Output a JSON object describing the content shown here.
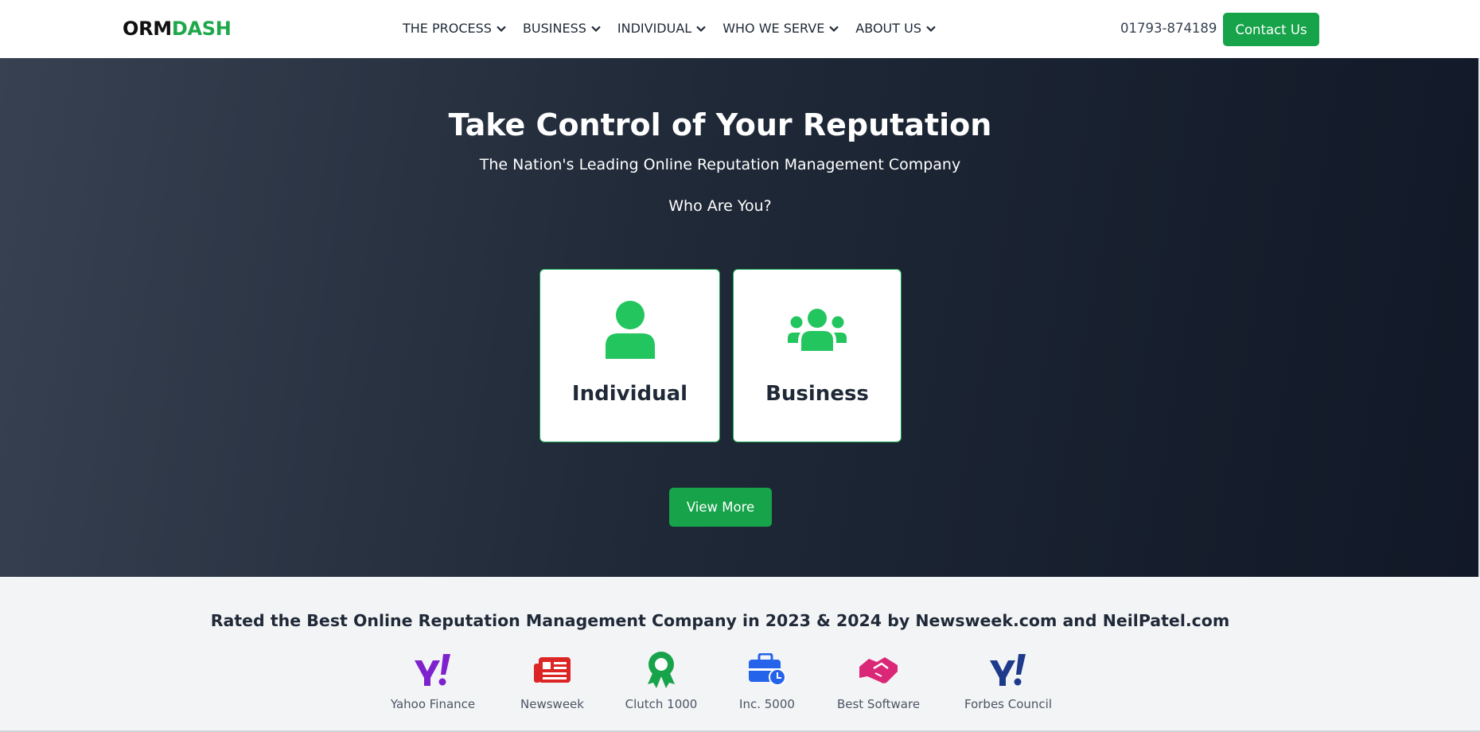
{
  "header": {
    "logo_part1": "ORM",
    "logo_part2": "DASH",
    "nav": [
      {
        "label": "THE PROCESS"
      },
      {
        "label": "BUSINESS"
      },
      {
        "label": "INDIVIDUAL"
      },
      {
        "label": "WHO WE SERVE"
      },
      {
        "label": "ABOUT US"
      }
    ],
    "phone": "01793-874189",
    "contact_label": "Contact Us"
  },
  "hero": {
    "title": "Take Control of Your Reputation",
    "subtitle": "The Nation's Leading Online Reputation Management Company",
    "question": "Who Are You?",
    "cards": [
      {
        "label": "Individual",
        "icon": "user-icon"
      },
      {
        "label": "Business",
        "icon": "users-group-icon"
      }
    ],
    "view_more_label": "View More"
  },
  "ratings": {
    "title": "Rated the Best Online Reputation Management Company in 2023 & 2024 by Newsweek.com and NeilPatel.com",
    "badges": [
      {
        "label": "Yahoo Finance",
        "icon": "yahoo-icon",
        "color": "#7e22ce"
      },
      {
        "label": "Newsweek",
        "icon": "newspaper-icon",
        "color": "#dc2626"
      },
      {
        "label": "Clutch 1000",
        "icon": "award-icon",
        "color": "#16a34a"
      },
      {
        "label": "Inc. 5000",
        "icon": "briefcase-clock-icon",
        "color": "#2563eb"
      },
      {
        "label": "Best Software",
        "icon": "handshake-icon",
        "color": "#db2777"
      },
      {
        "label": "Forbes Council",
        "icon": "yahoo-icon",
        "color": "#1e3a8a"
      }
    ]
  },
  "colors": {
    "brand_green": "#16a34a",
    "hero_dark": "#111827"
  }
}
